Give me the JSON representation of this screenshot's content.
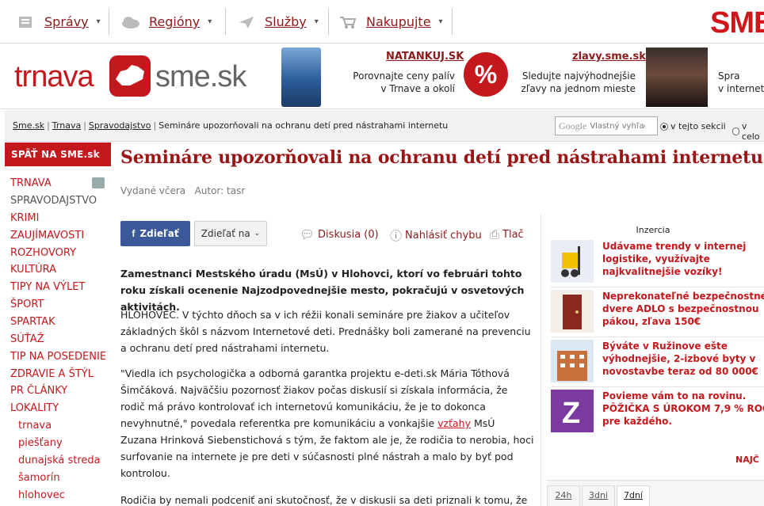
{
  "topnav": {
    "items": [
      {
        "label": "Správy",
        "icon": "newspaper-icon"
      },
      {
        "label": "Regióny",
        "icon": "cloud-icon"
      },
      {
        "label": "Služby",
        "icon": "paper-plane-icon"
      },
      {
        "label": "Nakupujte",
        "icon": "cart-icon"
      }
    ],
    "brand": "SME"
  },
  "header": {
    "logo_left": "trnava",
    "logo_right": "sme.sk",
    "promo1": {
      "title": "NATANKUJ.SK",
      "line1": "Porovnajte ceny palív",
      "line2": "v Trnave a okolí"
    },
    "promo2": {
      "badge": "%",
      "title": "zlavy.sme.sk",
      "line1": "Sledujte najvýhodnejšie",
      "line2": "zľavy na jednom mieste"
    },
    "promo3": {
      "line1": "Spra",
      "line2": "v internet"
    }
  },
  "breadcrumb": {
    "items": [
      "Sme.sk",
      "Trnava",
      "Spravodajstvo"
    ],
    "current": "Semináre upozorňovali na ochranu detí pred nástrahami internetu"
  },
  "search": {
    "brand": "Google",
    "placeholder": "Vlastný vyhľad",
    "option1": "v tejto sekcii",
    "option2": "v celo"
  },
  "sidebar": {
    "back": "SPÄŤ NA SME.sk",
    "items": [
      "TRNAVA",
      "SPRAVODAJSTVO",
      "KRIMI",
      "ZAUJÍMAVOSTI",
      "ROZHOVORY",
      "KULTÚRA",
      "TIPY NA VÝLET",
      "ŠPORT",
      "SPARTAK",
      "SÚŤAŽ",
      "TIP NA POSEDENIE",
      "ZDRAVIE A ŠTÝL",
      "PR ČLÁNKY",
      "LOKALITY"
    ],
    "subitems": [
      "trnava",
      "piešťany",
      "dunajská streda",
      "šamorín",
      "hlohovec"
    ]
  },
  "article": {
    "headline": "Semináre upozorňovali na ochranu detí pred nástrahami internetu",
    "meta": "Vydané včera   Autor: tasr",
    "share_fb": "Zdieľať",
    "share_more": "Zdieľať na",
    "discussion": "Diskusia (0)",
    "report": "Nahlásiť chybu",
    "print": "Tlač",
    "lead": "Zamestnanci Mestského úradu (MsÚ) v Hlohovci, ktorí vo februári tohto roku získali ocenenie Najzodpovednejšie mesto, pokračujú v osvetových aktivitách.",
    "p1": "HLOHOVEC. V týchto dňoch sa v ich réžii konali semináre pre žiakov a učiteľov základných škôl s názvom Internetové deti. Prednášky boli zamerané na prevenciu a ochranu detí pred nástrahami internetu.",
    "p2_a": "\"Viedla ich psychologička a odborná garantka projektu e-deti.sk Mária Tóthová Šimčáková. Najväčšiu pozornosť žiakov počas diskusií si získala informácia, že rodič má právo kontrolovať ich internetovú komunikáciu, že je to dokonca nevyhnutné,\" povedala referentka pre komunikáciu a vonkajšie ",
    "p2_link": "vzťahy",
    "p2_b": " MsÚ Zuzana Hrinková Siebenstichová s tým, že faktom ale je, že rodičia to nerobia, hoci surfovanie na internete je pre deti v súčasnosti plné nástrah a malo by byť pod kontrolou.",
    "p3": "Rodičia by nemali podceniť ani skutočnosť, že v diskusii sa deti priznali k tomu, že"
  },
  "ads": {
    "label": "Inzercia",
    "items": [
      {
        "lines": [
          "Udávame trendy v internej",
          "logistike, využívajte",
          "najkvalitnejšie vozíky!"
        ],
        "icon": "forklift-icon"
      },
      {
        "lines": [
          "Neprekonateľné bezpečnostné",
          "dvere ADLO s bezpečnostnou",
          "pákou, zľava 150€"
        ],
        "icon": "door-icon"
      },
      {
        "lines": [
          "Býváte v Ružinove ešte",
          "výhodnejšie, 2-izbové byty v",
          "novostavbe teraz od 80 000€"
        ],
        "icon": "building-icon"
      },
      {
        "lines": [
          "Povieme vám to na rovinu.",
          "PÔŽIČKA S ÚROKOM 7,9 % ROČNE",
          "pre každého."
        ],
        "icon": "z-logo-icon"
      }
    ],
    "more": "NAJČ",
    "tabs": [
      "24h",
      "3dni",
      "7dní"
    ]
  },
  "colors": {
    "brand_red": "#c5181d",
    "link_dark_red": "#8c1b1b",
    "facebook": "#3b5998"
  }
}
